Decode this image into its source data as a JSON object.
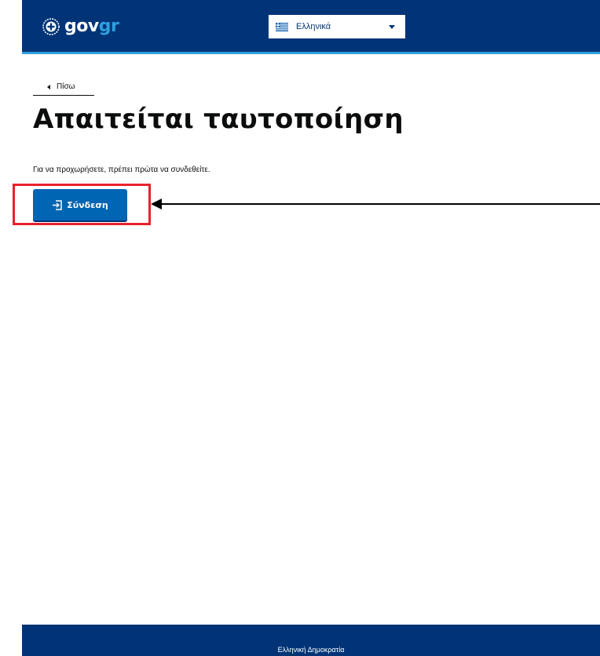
{
  "header": {
    "logo": {
      "gov": "gov",
      "gr": "gr"
    },
    "language": {
      "selected": "Ελληνικά",
      "flag_icon": "greek-flag-icon",
      "caret_icon": "chevron-down-icon"
    }
  },
  "back_link": {
    "label": "Πίσω",
    "icon": "chevron-left-icon"
  },
  "page": {
    "title": "Απαιτείται ταυτοποίηση",
    "description": "Για να προχωρήσετε, πρέπει πρώτα να συνδεθείτε."
  },
  "login_button": {
    "label": "Σύνδεση",
    "icon": "login-icon"
  },
  "annotation": {
    "highlight_color": "#e8212c",
    "arrow_color": "#000000"
  },
  "footer": {
    "text": "Ελληνική Δημοκρατία"
  },
  "colors": {
    "header_bg": "#003476",
    "accent": "#2e9fe0",
    "button_bg": "#0065b3"
  }
}
